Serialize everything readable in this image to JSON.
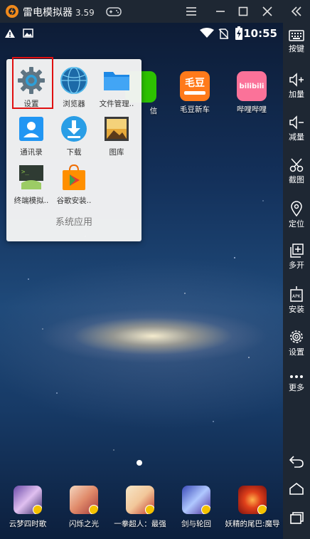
{
  "window": {
    "title": "雷电模拟器",
    "version": "3.59"
  },
  "status": {
    "time": "10:55"
  },
  "home_icons": [
    {
      "label": "毛豆新车",
      "brand_text": "毛豆"
    },
    {
      "label": "哔哩哔哩",
      "brand_text": "bilibili"
    },
    {
      "label": "信"
    }
  ],
  "folder": {
    "title": "系统应用",
    "apps": [
      "设置",
      "浏览器",
      "文件管理..",
      "通讯录",
      "下载",
      "图库",
      "终端模拟..",
      "谷歌安装.."
    ]
  },
  "dock": [
    "云梦四时歌",
    "闪烁之光",
    "一拳超人：最强",
    "剑与轮回",
    "妖精的尾巴:魔导"
  ],
  "sidebar": [
    "按键",
    "加量",
    "减量",
    "截图",
    "定位",
    "多开",
    "安装",
    "设置",
    "更多"
  ],
  "colors": {
    "titlebar": "#1e2733",
    "accent_red": "#e01010",
    "logo_orange": "#f08a1c"
  }
}
